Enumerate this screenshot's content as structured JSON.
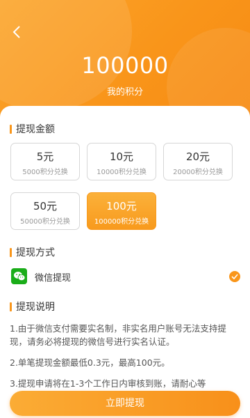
{
  "header": {
    "points_value": "100000",
    "points_label": "我的积分"
  },
  "amount_section": {
    "title": "提现金额",
    "options": [
      {
        "amount": "5元",
        "cost": "5000积分兑换",
        "selected": false
      },
      {
        "amount": "10元",
        "cost": "10000积分兑换",
        "selected": false
      },
      {
        "amount": "20元",
        "cost": "20000积分兑换",
        "selected": false
      },
      {
        "amount": "50元",
        "cost": "50000积分兑换",
        "selected": false
      },
      {
        "amount": "100元",
        "cost": "100000积分兑换",
        "selected": true
      }
    ]
  },
  "method_section": {
    "title": "提现方式",
    "method_label": "微信提现",
    "method_icon": "wechat-icon",
    "checked": true
  },
  "notes_section": {
    "title": "提现说明",
    "items": [
      "1.由于微信支付需要实名制，非实名用户账号无法支持提现，请务必将提现的微信号进行实名认证。",
      "2.单笔提现金额最低0.3元，最高100元。",
      "3.提现申请将在1-3个工作日内审核到账，请耐心等"
    ]
  },
  "submit_label": "立即提现",
  "colors": {
    "accent": "#f9961b",
    "wechat": "#1aad19"
  }
}
